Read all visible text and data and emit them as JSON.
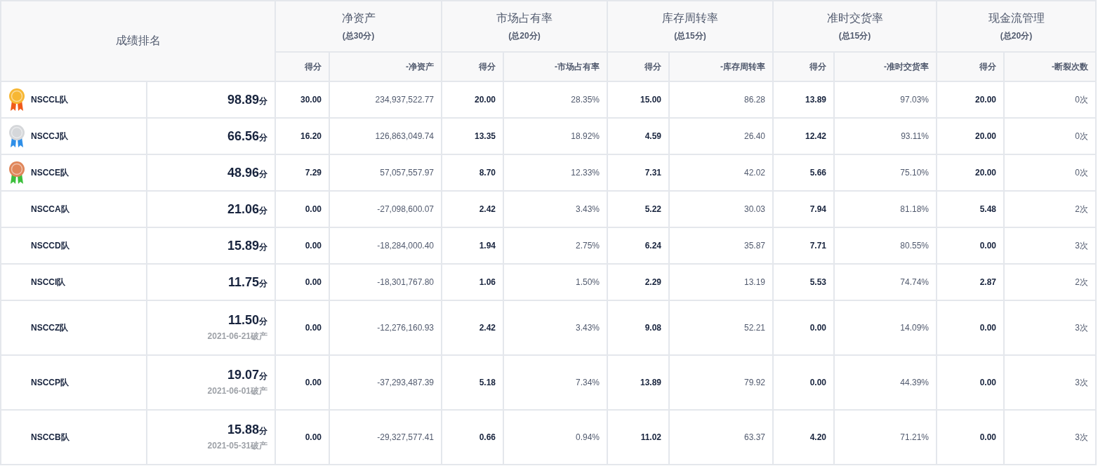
{
  "table": {
    "rank_header": "成绩排名",
    "groups": [
      {
        "title": "净资产",
        "subtitle": "(总30分)",
        "columns": [
          "得分",
          "-净资产"
        ]
      },
      {
        "title": "市场占有率",
        "subtitle": "(总20分)",
        "columns": [
          "得分",
          "-市场占有率"
        ]
      },
      {
        "title": "库存周转率",
        "subtitle": "(总15分)",
        "columns": [
          "得分",
          "-库存周转率"
        ]
      },
      {
        "title": "准时交货率",
        "subtitle": "(总15分)",
        "columns": [
          "得分",
          "-准时交货率"
        ]
      },
      {
        "title": "现金流管理",
        "subtitle": "(总20分)",
        "columns": [
          "得分",
          "-断裂次数"
        ]
      }
    ],
    "rows": [
      {
        "medal": {
          "color": "#f7b733",
          "ribbon": {
            "color": "#f05a1a"
          }
        },
        "team": "NSCCL队",
        "score": "98.89",
        "unit": "分",
        "cells": [
          "30.00",
          "234,937,522.77",
          "20.00",
          "28.35%",
          "15.00",
          "86.28",
          "13.89",
          "97.03%",
          "20.00",
          "0次"
        ]
      },
      {
        "medal": {
          "color": "#d5d7da",
          "ribbon": {
            "color": "#2f8fe8"
          }
        },
        "team": "NSCCJ队",
        "score": "66.56",
        "unit": "分",
        "cells": [
          "16.20",
          "126,863,049.74",
          "13.35",
          "18.92%",
          "4.59",
          "26.40",
          "12.42",
          "93.11%",
          "20.00",
          "0次"
        ]
      },
      {
        "medal": {
          "color": "#e0865a",
          "ribbon": {
            "color": "#3cbf3c"
          }
        },
        "team": "NSCCE队",
        "score": "48.96",
        "unit": "分",
        "cells": [
          "7.29",
          "57,057,557.97",
          "8.70",
          "12.33%",
          "7.31",
          "42.02",
          "5.66",
          "75.10%",
          "20.00",
          "0次"
        ]
      },
      {
        "team": "NSCCA队",
        "score": "21.06",
        "unit": "分",
        "cells": [
          "0.00",
          "-27,098,600.07",
          "2.42",
          "3.43%",
          "5.22",
          "30.03",
          "7.94",
          "81.18%",
          "5.48",
          "2次"
        ]
      },
      {
        "team": "NSCCD队",
        "score": "15.89",
        "unit": "分",
        "cells": [
          "0.00",
          "-18,284,000.40",
          "1.94",
          "2.75%",
          "6.24",
          "35.87",
          "7.71",
          "80.55%",
          "0.00",
          "3次"
        ]
      },
      {
        "team": "NSCCI队",
        "score": "11.75",
        "unit": "分",
        "cells": [
          "0.00",
          "-18,301,767.80",
          "1.06",
          "1.50%",
          "2.29",
          "13.19",
          "5.53",
          "74.74%",
          "2.87",
          "2次"
        ]
      },
      {
        "team": "NSCCZ队",
        "score": "11.50",
        "unit": "分",
        "bankrupt": "2021-06-21破产",
        "cells": [
          "0.00",
          "-12,276,160.93",
          "2.42",
          "3.43%",
          "9.08",
          "52.21",
          "0.00",
          "14.09%",
          "0.00",
          "3次"
        ]
      },
      {
        "team": "NSCCP队",
        "score": "19.07",
        "unit": "分",
        "bankrupt": "2021-06-01破产",
        "cells": [
          "0.00",
          "-37,293,487.39",
          "5.18",
          "7.34%",
          "13.89",
          "79.92",
          "0.00",
          "44.39%",
          "0.00",
          "3次"
        ]
      },
      {
        "team": "NSCCB队",
        "score": "15.88",
        "unit": "分",
        "bankrupt": "2021-05-31破产",
        "cells": [
          "0.00",
          "-29,327,577.41",
          "0.66",
          "0.94%",
          "11.02",
          "63.37",
          "4.20",
          "71.21%",
          "0.00",
          "3次"
        ]
      }
    ]
  }
}
